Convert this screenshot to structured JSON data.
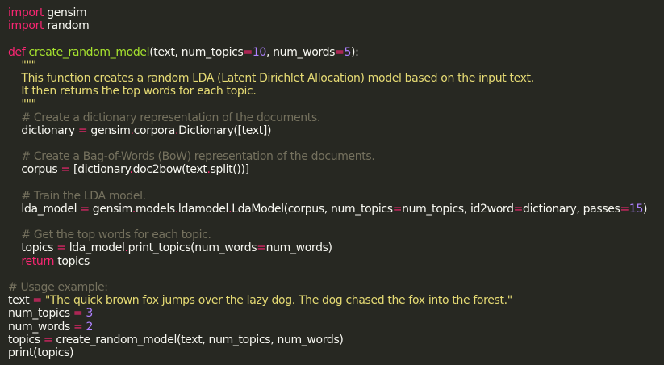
{
  "editor": {
    "theme": {
      "background": "#272822",
      "keyword": "#f92672",
      "function": "#a6e22e",
      "number": "#ae81ff",
      "string": "#e6db74",
      "comment": "#75715e",
      "text": "#f8f8f2"
    },
    "lines": [
      [
        {
          "t": "kw",
          "v": "import"
        },
        {
          "t": "tx",
          "v": " gensim"
        }
      ],
      [
        {
          "t": "kw",
          "v": "import"
        },
        {
          "t": "tx",
          "v": " random"
        }
      ],
      [],
      [
        {
          "t": "kw",
          "v": "def"
        },
        {
          "t": "tx",
          "v": " "
        },
        {
          "t": "fn",
          "v": "create_random_model"
        },
        {
          "t": "tx",
          "v": "(text, num_topics"
        },
        {
          "t": "op",
          "v": "="
        },
        {
          "t": "num",
          "v": "10"
        },
        {
          "t": "tx",
          "v": ", num_words"
        },
        {
          "t": "op",
          "v": "="
        },
        {
          "t": "num",
          "v": "5"
        },
        {
          "t": "tx",
          "v": "):"
        }
      ],
      [
        {
          "t": "tx",
          "v": "    "
        },
        {
          "t": "str",
          "v": "\"\"\""
        }
      ],
      [
        {
          "t": "str",
          "v": "    This function creates a random LDA (Latent Dirichlet Allocation) model based on the input text."
        }
      ],
      [
        {
          "t": "str",
          "v": "    It then returns the top words for each topic."
        }
      ],
      [
        {
          "t": "str",
          "v": "    \"\"\""
        }
      ],
      [
        {
          "t": "tx",
          "v": "    "
        },
        {
          "t": "cm",
          "v": "# Create a dictionary representation of the documents."
        }
      ],
      [
        {
          "t": "tx",
          "v": "    dictionary "
        },
        {
          "t": "op",
          "v": "="
        },
        {
          "t": "tx",
          "v": " gensim"
        },
        {
          "t": "op",
          "v": "."
        },
        {
          "t": "tx",
          "v": "corpora"
        },
        {
          "t": "op",
          "v": "."
        },
        {
          "t": "tx",
          "v": "Dictionary([text])"
        }
      ],
      [],
      [
        {
          "t": "tx",
          "v": "    "
        },
        {
          "t": "cm",
          "v": "# Create a Bag-of-Words (BoW) representation of the documents."
        }
      ],
      [
        {
          "t": "tx",
          "v": "    corpus "
        },
        {
          "t": "op",
          "v": "="
        },
        {
          "t": "tx",
          "v": " [dictionary"
        },
        {
          "t": "op",
          "v": "."
        },
        {
          "t": "tx",
          "v": "doc2bow(text"
        },
        {
          "t": "op",
          "v": "."
        },
        {
          "t": "tx",
          "v": "split())]"
        }
      ],
      [],
      [
        {
          "t": "tx",
          "v": "    "
        },
        {
          "t": "cm",
          "v": "# Train the LDA model."
        }
      ],
      [
        {
          "t": "tx",
          "v": "    lda_model "
        },
        {
          "t": "op",
          "v": "="
        },
        {
          "t": "tx",
          "v": " gensim"
        },
        {
          "t": "op",
          "v": "."
        },
        {
          "t": "tx",
          "v": "models"
        },
        {
          "t": "op",
          "v": "."
        },
        {
          "t": "tx",
          "v": "ldamodel"
        },
        {
          "t": "op",
          "v": "."
        },
        {
          "t": "tx",
          "v": "LdaModel(corpus, num_topics"
        },
        {
          "t": "op",
          "v": "="
        },
        {
          "t": "tx",
          "v": "num_topics, id2word"
        },
        {
          "t": "op",
          "v": "="
        },
        {
          "t": "tx",
          "v": "dictionary, passes"
        },
        {
          "t": "op",
          "v": "="
        },
        {
          "t": "num",
          "v": "15"
        },
        {
          "t": "tx",
          "v": ")"
        }
      ],
      [],
      [
        {
          "t": "tx",
          "v": "    "
        },
        {
          "t": "cm",
          "v": "# Get the top words for each topic."
        }
      ],
      [
        {
          "t": "tx",
          "v": "    topics "
        },
        {
          "t": "op",
          "v": "="
        },
        {
          "t": "tx",
          "v": " lda_model"
        },
        {
          "t": "op",
          "v": "."
        },
        {
          "t": "tx",
          "v": "print_topics(num_words"
        },
        {
          "t": "op",
          "v": "="
        },
        {
          "t": "tx",
          "v": "num_words)"
        }
      ],
      [
        {
          "t": "tx",
          "v": "    "
        },
        {
          "t": "kw",
          "v": "return"
        },
        {
          "t": "tx",
          "v": " topics"
        }
      ],
      [],
      [
        {
          "t": "cm",
          "v": "# Usage example:"
        }
      ],
      [
        {
          "t": "tx",
          "v": "text "
        },
        {
          "t": "op",
          "v": "="
        },
        {
          "t": "tx",
          "v": " "
        },
        {
          "t": "str",
          "v": "\"The quick brown fox jumps over the lazy dog. The dog chased the fox into the forest.\""
        }
      ],
      [
        {
          "t": "tx",
          "v": "num_topics "
        },
        {
          "t": "op",
          "v": "="
        },
        {
          "t": "tx",
          "v": " "
        },
        {
          "t": "num",
          "v": "3"
        }
      ],
      [
        {
          "t": "tx",
          "v": "num_words "
        },
        {
          "t": "op",
          "v": "="
        },
        {
          "t": "tx",
          "v": " "
        },
        {
          "t": "num",
          "v": "2"
        }
      ],
      [
        {
          "t": "tx",
          "v": "topics "
        },
        {
          "t": "op",
          "v": "="
        },
        {
          "t": "tx",
          "v": " create_random_model(text, num_topics, num_words)"
        }
      ],
      [
        {
          "t": "tx",
          "v": "print(topics)"
        }
      ]
    ]
  }
}
